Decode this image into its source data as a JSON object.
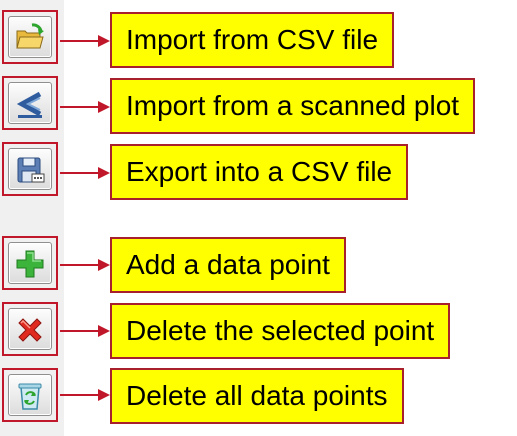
{
  "toolbar": {
    "items": [
      {
        "icon": "folder-open-import-icon",
        "label": "Import from CSV file"
      },
      {
        "icon": "scanned-plot-import-icon",
        "label": "Import from a scanned plot"
      },
      {
        "icon": "floppy-disk-export-icon",
        "label": "Export into a CSV file"
      },
      {
        "icon": "green-plus-icon",
        "label": "Add a data point"
      },
      {
        "icon": "red-x-icon",
        "label": "Delete the selected point"
      },
      {
        "icon": "recycle-bin-icon",
        "label": "Delete all data points"
      }
    ]
  },
  "colors": {
    "callout_fill": "#ffff00",
    "callout_border": "#a8202c",
    "arrow": "#c0182a",
    "toolbar_bg": "#f0f0f0"
  }
}
